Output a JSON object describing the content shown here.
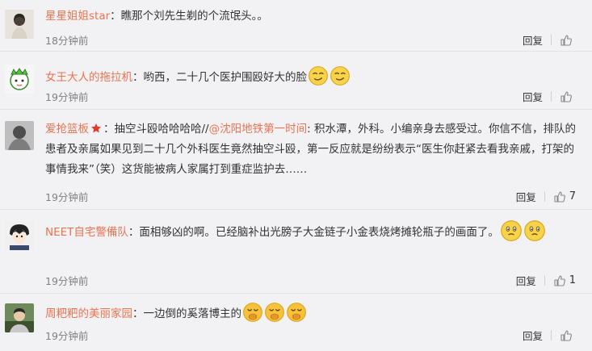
{
  "comments": [
    {
      "username": "星星姐姐star",
      "text": "：瞧那个刘先生剃的个流氓头。。",
      "time": "18分钟前",
      "reply_label": "回复",
      "likes": ""
    },
    {
      "username": "女王大人的拖拉机",
      "text": "：哟西，二十几个医护围殴好大的脸",
      "time": "19分钟前",
      "reply_label": "回复",
      "likes": ""
    },
    {
      "username": "爱抢篮板",
      "text_before": "：抽空斗殴哈哈哈哈//",
      "mention": "@沈阳地铁第一时间",
      "text_after": ": 积水潭，外科。小编亲身去感受过。你信不信，排队的患者及亲属如果见到二十几个外科医生竟然抽空斗殴，第一反应就是纷纷表示“医生你赶紧去看我亲戚，打架的事情我来”（笑）这货能被病人家属打到重症监护去……",
      "time": "19分钟前",
      "reply_label": "回复",
      "likes": "7"
    },
    {
      "username": "NEET自宅警備队",
      "text": "：面相够凶的啊。已经脑补出光膀子大金链子小金表烧烤摊轮瓶子的画面了。",
      "time": "19分钟前",
      "reply_label": "回复",
      "likes": "1"
    },
    {
      "username": "周粑粑的美丽家园",
      "text": "：一边倒的奚落博主的",
      "time": "19分钟前",
      "reply_label": "回复",
      "likes": ""
    }
  ],
  "icons": {
    "like": "thumbs-up-icon",
    "vip_badge": "star-badge-icon",
    "emoji_smirk": "smirk-emoji-icon",
    "emoji_shy": "shy-emoji-icon",
    "emoji_giggle": "giggle-emoji-icon"
  },
  "colors": {
    "username": "#eb7350",
    "meta": "#808080",
    "background": "#f2f2f5"
  }
}
